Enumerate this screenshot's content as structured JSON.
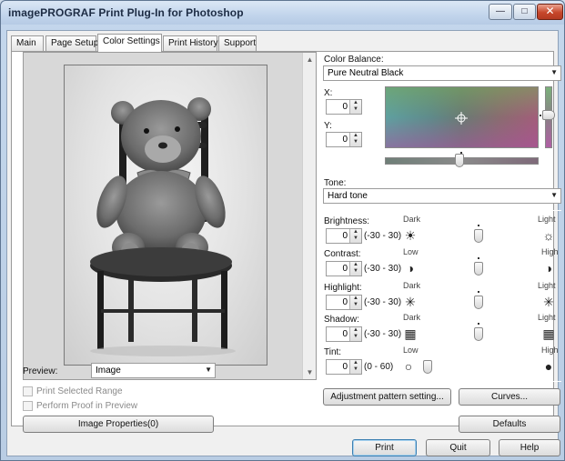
{
  "window": {
    "title": "imagePROGRAF Print Plug-In for Photoshop",
    "controls": [
      "minimize-icon",
      "maximize-icon",
      "close-icon"
    ]
  },
  "tabs": [
    {
      "label": "Main",
      "active": false
    },
    {
      "label": "Page Setup",
      "active": false
    },
    {
      "label": "Color Settings",
      "active": true
    },
    {
      "label": "Print History",
      "active": false
    },
    {
      "label": "Support",
      "active": false
    }
  ],
  "left": {
    "preview_label": "Preview:",
    "preview_value": "Image",
    "print_selected_range": "Print Selected Range",
    "perform_proof": "Perform Proof in Preview",
    "image_properties": "Image Properties(0)"
  },
  "color_balance": {
    "label": "Color Balance:",
    "value": "Pure Neutral Black",
    "x_label": "X:",
    "x_value": "0",
    "y_label": "Y:",
    "y_value": "0"
  },
  "tone": {
    "label": "Tone:",
    "value": "Hard tone"
  },
  "adjust": [
    {
      "key": "brightness",
      "label": "Brightness:",
      "value": "0",
      "range": "(-30 - 30)",
      "low": "Dark",
      "high": "Light",
      "low_icon": "sun-small-icon",
      "high_icon": "sun-large-icon",
      "level": 0.5
    },
    {
      "key": "contrast",
      "label": "Contrast:",
      "value": "0",
      "range": "(-30 - 30)",
      "low": "Low",
      "high": "High",
      "low_icon": "contrast-low-icon",
      "high_icon": "contrast-high-icon",
      "level": 0.5
    },
    {
      "key": "highlight",
      "label": "Highlight:",
      "value": "0",
      "range": "(-30 - 30)",
      "low": "Dark",
      "high": "Light",
      "low_icon": "highlight-dark-icon",
      "high_icon": "highlight-light-icon",
      "level": 0.5
    },
    {
      "key": "shadow",
      "label": "Shadow:",
      "value": "0",
      "range": "(-30 - 30)",
      "low": "Dark",
      "high": "Light",
      "low_icon": "shadow-dark-icon",
      "high_icon": "shadow-light-icon",
      "level": 0.5
    },
    {
      "key": "tint",
      "label": "Tint:",
      "value": "0",
      "range": "(0 - 60)",
      "low": "Low",
      "high": "High",
      "low_icon": "tint-low-icon",
      "high_icon": "tint-high-icon",
      "level": 0.0
    }
  ],
  "buttons": {
    "adjustment_pattern": "Adjustment pattern setting...",
    "curves": "Curves...",
    "defaults": "Defaults",
    "print": "Print",
    "quit": "Quit",
    "help": "Help"
  }
}
